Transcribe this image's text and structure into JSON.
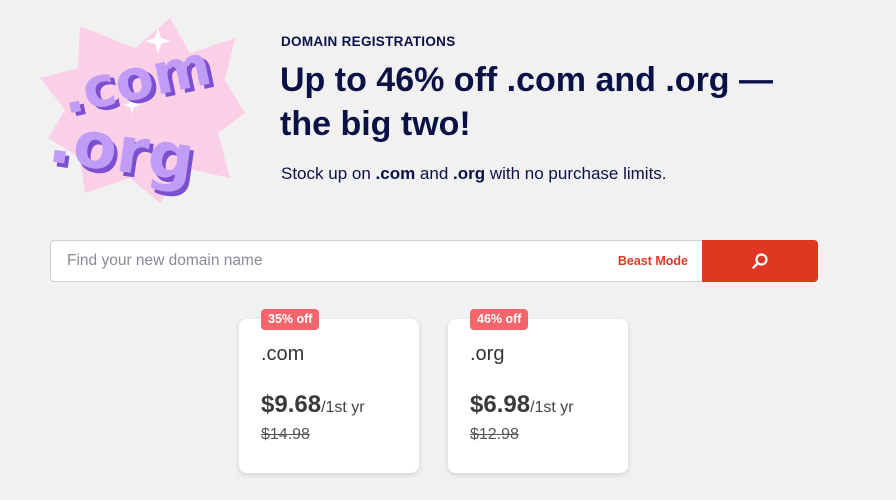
{
  "hero": {
    "art_text_top": ".com",
    "art_text_bottom": ".org",
    "eyebrow": "DOMAIN REGISTRATIONS",
    "headline_line1": "Up to 46% off .com and .org —",
    "headline_line2": "the big two!",
    "subline_prefix": "Stock up on ",
    "subline_com": ".com",
    "subline_and": " and ",
    "subline_org": ".org",
    "subline_suffix": " with no purchase limits."
  },
  "search": {
    "placeholder": "Find your new domain name",
    "beast_mode_label": "Beast Mode",
    "button_icon": "search-icon"
  },
  "cards": [
    {
      "badge": "35% off",
      "tld": ".com",
      "price": "$9.68",
      "term": "/1st yr",
      "old_price": "$14.98"
    },
    {
      "badge": "46% off",
      "tld": ".org",
      "price": "$6.98",
      "term": "/1st yr",
      "old_price": "$12.98"
    }
  ],
  "colors": {
    "brand_red": "#df3722",
    "badge_pink": "#f2656a",
    "navy_text": "#0a1145",
    "art_purple": "#b98df2",
    "art_pink": "#fbcde6"
  }
}
